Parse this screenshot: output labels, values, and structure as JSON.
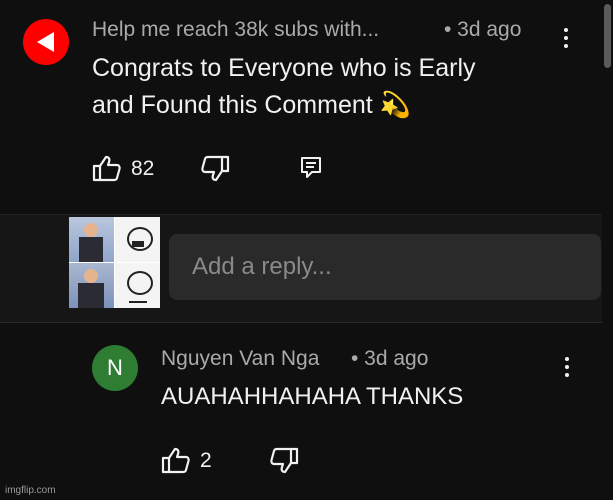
{
  "comment": {
    "author": "Help me reach 38k subs with...",
    "time": "• 3d ago",
    "line1": "Congrats to Everyone who is Early",
    "line2": "and Found this Comment 💫",
    "likes": "82"
  },
  "reply_box": {
    "placeholder": "Add a reply..."
  },
  "reply": {
    "avatar_letter": "N",
    "author": "Nguyen Van Nga",
    "time": "• 3d ago",
    "text": "AUAHAHHAHAHA THANKS",
    "likes": "2"
  },
  "watermark": "imgflip.com",
  "colors": {
    "background": "#0f0f0f",
    "channel_avatar": "#ff0000",
    "reply_avatar": "#2e7d32"
  },
  "icons": {
    "like": "thumbs-up-icon",
    "dislike": "thumbs-down-icon",
    "reply": "reply-comment-icon",
    "menu": "kebab-menu-icon"
  }
}
